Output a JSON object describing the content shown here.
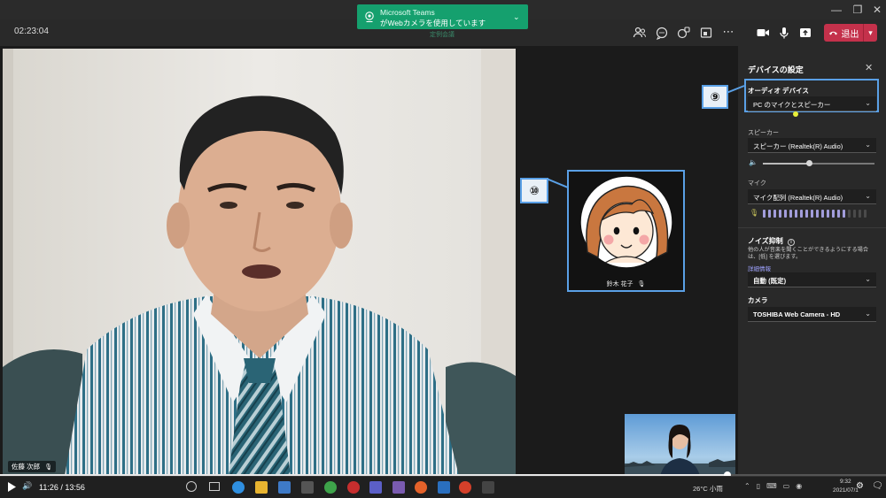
{
  "meeting": {
    "timer": "02:23:04",
    "watermark": "定例会議"
  },
  "notification": {
    "app": "Microsoft Teams",
    "message": "がWebカメラを使用しています"
  },
  "toolbar": {
    "leave_label": "退出",
    "icons": [
      "participants-icon",
      "chat-icon",
      "reactions-icon",
      "share-tray-icon",
      "more-icon",
      "camera-icon",
      "mic-icon",
      "share-icon"
    ]
  },
  "stage": {
    "main_participant_name": "佐藤 次郎",
    "tile_participant_name": "鈴木 花子",
    "callout_audio": "⑨",
    "callout_tile": "⑩"
  },
  "device_settings": {
    "title": "デバイスの設定",
    "audio_device_label": "オーディオ デバイス",
    "audio_device_value": "PC のマイクとスピーカー",
    "speaker_label": "スピーカー",
    "speaker_value": "スピーカー (Realtek(R) Audio)",
    "speaker_volume": 0.41,
    "mic_label": "マイク",
    "mic_value": "マイク配列 (Realtek(R) Audio)",
    "mic_level_active_bars": 16,
    "mic_level_total_bars": 20,
    "noise_title": "ノイズ抑制",
    "noise_desc": "他の人が音楽を聞くことができるようにする場合は、[低] を選びます。",
    "noise_link": "詳細情報",
    "noise_value": "自動 (既定)",
    "camera_label": "カメラ",
    "camera_value": "TOSHIBA Web Camera - HD"
  },
  "player": {
    "time": "11:26 / 13:56",
    "progress": 0.821
  },
  "taskbar": {
    "weather": "26°C 小雨",
    "clock_time": "9:32",
    "clock_date": "2021/07/1"
  },
  "colors": {
    "leave_red": "#c4314b",
    "notification_green": "#15a06e",
    "highlight_blue": "#5aa0e6",
    "mic_level_purple": "#a29ddb"
  }
}
